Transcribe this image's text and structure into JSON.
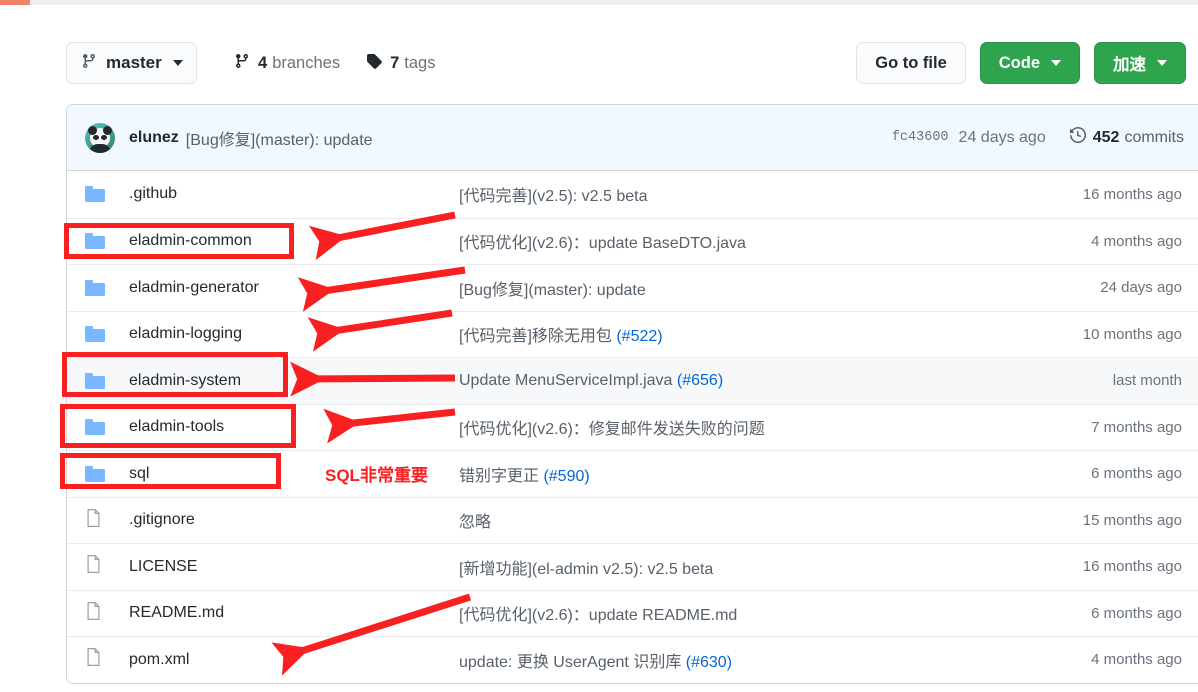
{
  "progress": {
    "percent": 2.5,
    "color": "#f28267"
  },
  "toolbar": {
    "branch_name": "master",
    "branches_count": "4",
    "branches_label": "branches",
    "tags_count": "7",
    "tags_label": "tags",
    "go_to_file_label": "Go to file",
    "code_label": "Code",
    "accelerate_label": "加速"
  },
  "commit_header": {
    "author": "elunez",
    "message": "[Bug修复](master): update",
    "sha": "fc43600",
    "date": "24 days ago",
    "commits_number": "452",
    "commits_label": "commits"
  },
  "files": [
    {
      "type": "folder",
      "name": ".github",
      "message": "[代码完善](v2.5): v2.5 beta",
      "pr": "",
      "age": "16 months ago",
      "highlight": false
    },
    {
      "type": "folder",
      "name": "eladmin-common",
      "message": "[代码优化](v2.6)：update BaseDTO.java",
      "pr": "",
      "age": "4 months ago",
      "highlight": false
    },
    {
      "type": "folder",
      "name": "eladmin-generator",
      "message": "[Bug修复](master): update",
      "pr": "",
      "age": "24 days ago",
      "highlight": false
    },
    {
      "type": "folder",
      "name": "eladmin-logging",
      "message": "[代码完善]移除无用包 ",
      "pr": "(#522)",
      "age": "10 months ago",
      "highlight": false
    },
    {
      "type": "folder",
      "name": "eladmin-system",
      "message": "Update MenuServiceImpl.java ",
      "pr": "(#656)",
      "age": "last month",
      "highlight": true
    },
    {
      "type": "folder",
      "name": "eladmin-tools",
      "message": "[代码优化](v2.6)：修复邮件发送失败的问题",
      "pr": "",
      "age": "7 months ago",
      "highlight": false
    },
    {
      "type": "folder",
      "name": "sql",
      "message": "错别字更正 ",
      "pr": "(#590)",
      "age": "6 months ago",
      "highlight": false
    },
    {
      "type": "file",
      "name": ".gitignore",
      "message": "忽略",
      "pr": "",
      "age": "15 months ago",
      "highlight": false
    },
    {
      "type": "file",
      "name": "LICENSE",
      "message": "[新增功能](el-admin v2.5): v2.5 beta",
      "pr": "",
      "age": "16 months ago",
      "highlight": false
    },
    {
      "type": "file",
      "name": "README.md",
      "message": "[代码优化](v2.6)：update README.md",
      "pr": "",
      "age": "6 months ago",
      "highlight": false
    },
    {
      "type": "file",
      "name": "pom.xml",
      "message": "update: 更换 UserAgent 识别库 ",
      "pr": "(#630)",
      "age": "4 months ago",
      "highlight": false
    }
  ],
  "annotations": {
    "sql_note": "SQL非常重要",
    "box_color": "#f82020",
    "arrow_color": "#f82020"
  }
}
